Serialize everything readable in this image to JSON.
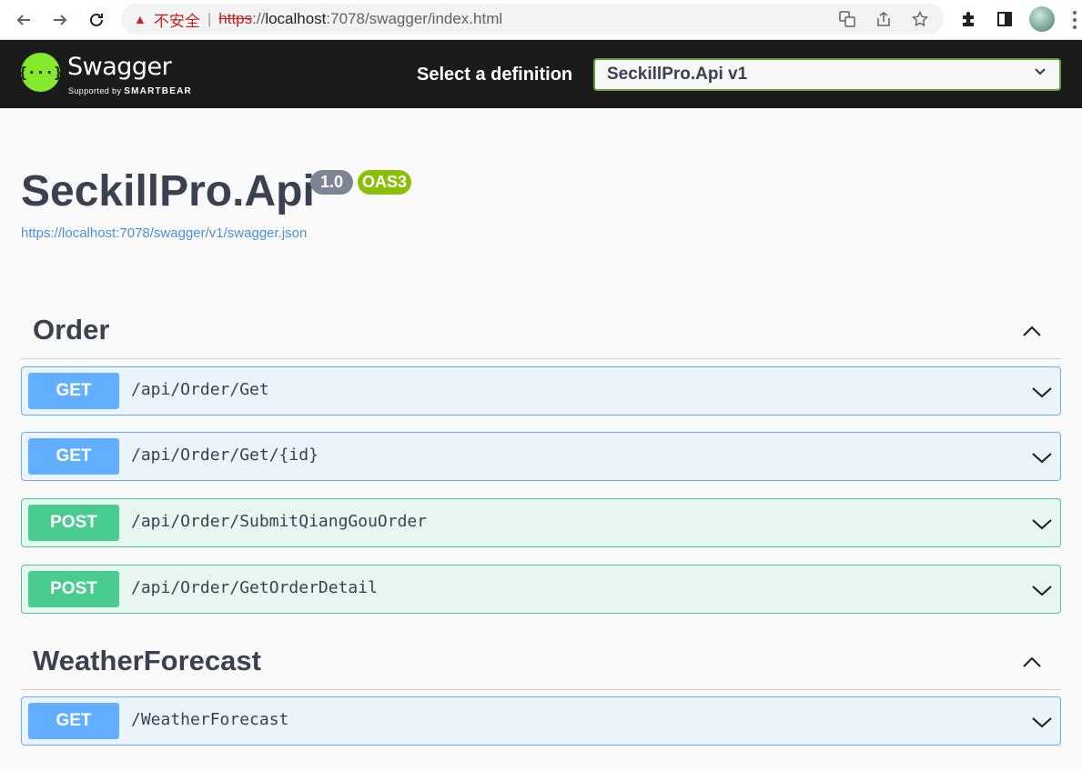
{
  "browser": {
    "security_label": "不安全",
    "separator": "|",
    "url_scheme": "https",
    "url_sep": "://",
    "url_host": "localhost",
    "url_path": ":7078/swagger/index.html"
  },
  "topbar": {
    "logo_mark": "{···}",
    "logo_text": "Swagger",
    "logo_supported": "Supported by",
    "logo_brand": "SMARTBEAR",
    "definition_label": "Select a definition",
    "definition_value": "SeckillPro.Api v1"
  },
  "info": {
    "title": "SeckillPro.Api",
    "version": "1.0",
    "oas": "OAS3",
    "spec_url": "https://localhost:7078/swagger/v1/swagger.json"
  },
  "sections": [
    {
      "name": "Order",
      "operations": [
        {
          "method": "GET",
          "path": "/api/Order/Get"
        },
        {
          "method": "GET",
          "path": "/api/Order/Get/{id}"
        },
        {
          "method": "POST",
          "path": "/api/Order/SubmitQiangGouOrder"
        },
        {
          "method": "POST",
          "path": "/api/Order/GetOrderDetail"
        }
      ]
    },
    {
      "name": "WeatherForecast",
      "operations": [
        {
          "method": "GET",
          "path": "/WeatherForecast"
        }
      ]
    }
  ],
  "colors": {
    "get": "#61affe",
    "post": "#49cc90",
    "topbar": "#1b1b1b",
    "logo": "#85ea2d"
  }
}
